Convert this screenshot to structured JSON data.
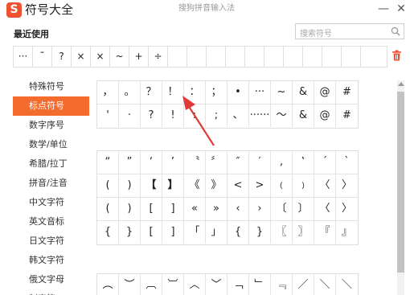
{
  "app": {
    "title": "符号大全",
    "window_title": "搜狗拼音输入法",
    "logo_letter": "S",
    "minimize": "—",
    "close": "✕"
  },
  "recent": {
    "label": "最近使用",
    "symbols": [
      "···",
      "˜",
      "?",
      "×",
      "×",
      "~",
      "+",
      "÷",
      "",
      "",
      "",
      "",
      "",
      "",
      "",
      "",
      "",
      ""
    ]
  },
  "search": {
    "placeholder": "搜索符号"
  },
  "sidebar": {
    "items": [
      {
        "label": "特殊符号",
        "active": false
      },
      {
        "label": "标点符号",
        "active": true
      },
      {
        "label": "数字序号",
        "active": false
      },
      {
        "label": "数学/单位",
        "active": false
      },
      {
        "label": "希腊/拉丁",
        "active": false
      },
      {
        "label": "拼音/注音",
        "active": false
      },
      {
        "label": "中文字符",
        "active": false
      },
      {
        "label": "英文音标",
        "active": false
      },
      {
        "label": "日文字符",
        "active": false
      },
      {
        "label": "韩文字符",
        "active": false
      },
      {
        "label": "俄文字母",
        "active": false
      },
      {
        "label": "制表符",
        "active": false
      }
    ]
  },
  "grid1": [
    [
      "，",
      "。",
      "？",
      "！",
      "：",
      "；",
      "•",
      "···",
      "~",
      "&",
      "@",
      "#"
    ],
    [
      "'",
      "·",
      "?",
      "!",
      ":",
      ";",
      "、",
      "······",
      "～",
      "&",
      "@",
      "#"
    ]
  ],
  "grid2": [
    [
      "“",
      "”",
      "‘",
      "’",
      "〝",
      "〞",
      "″",
      "′",
      "‚",
      "‛",
      "´",
      "ˋ"
    ],
    [
      "(",
      ")",
      "【",
      "】",
      "《",
      "》",
      "<",
      ">",
      "﹙",
      "﹚",
      "〈",
      "〉"
    ],
    [
      "(",
      ")",
      "[",
      "]",
      "«",
      "»",
      "‹",
      "›",
      "〔",
      "〕",
      "〈",
      "〉"
    ],
    [
      "{",
      "}",
      "[",
      "]",
      "「",
      "」",
      "{",
      "}",
      "〖",
      "〗",
      "『",
      "』"
    ]
  ],
  "grid3": [
    [
      "︵",
      "︶",
      "︹",
      "︺",
      "︿",
      "﹀",
      "﹁",
      "﹂",
      "﹃",
      "／",
      "＼",
      "＼"
    ]
  ],
  "colors": {
    "accent": "#f46b2e",
    "logo": "#f0512f",
    "arrow": "#e23a3a"
  }
}
